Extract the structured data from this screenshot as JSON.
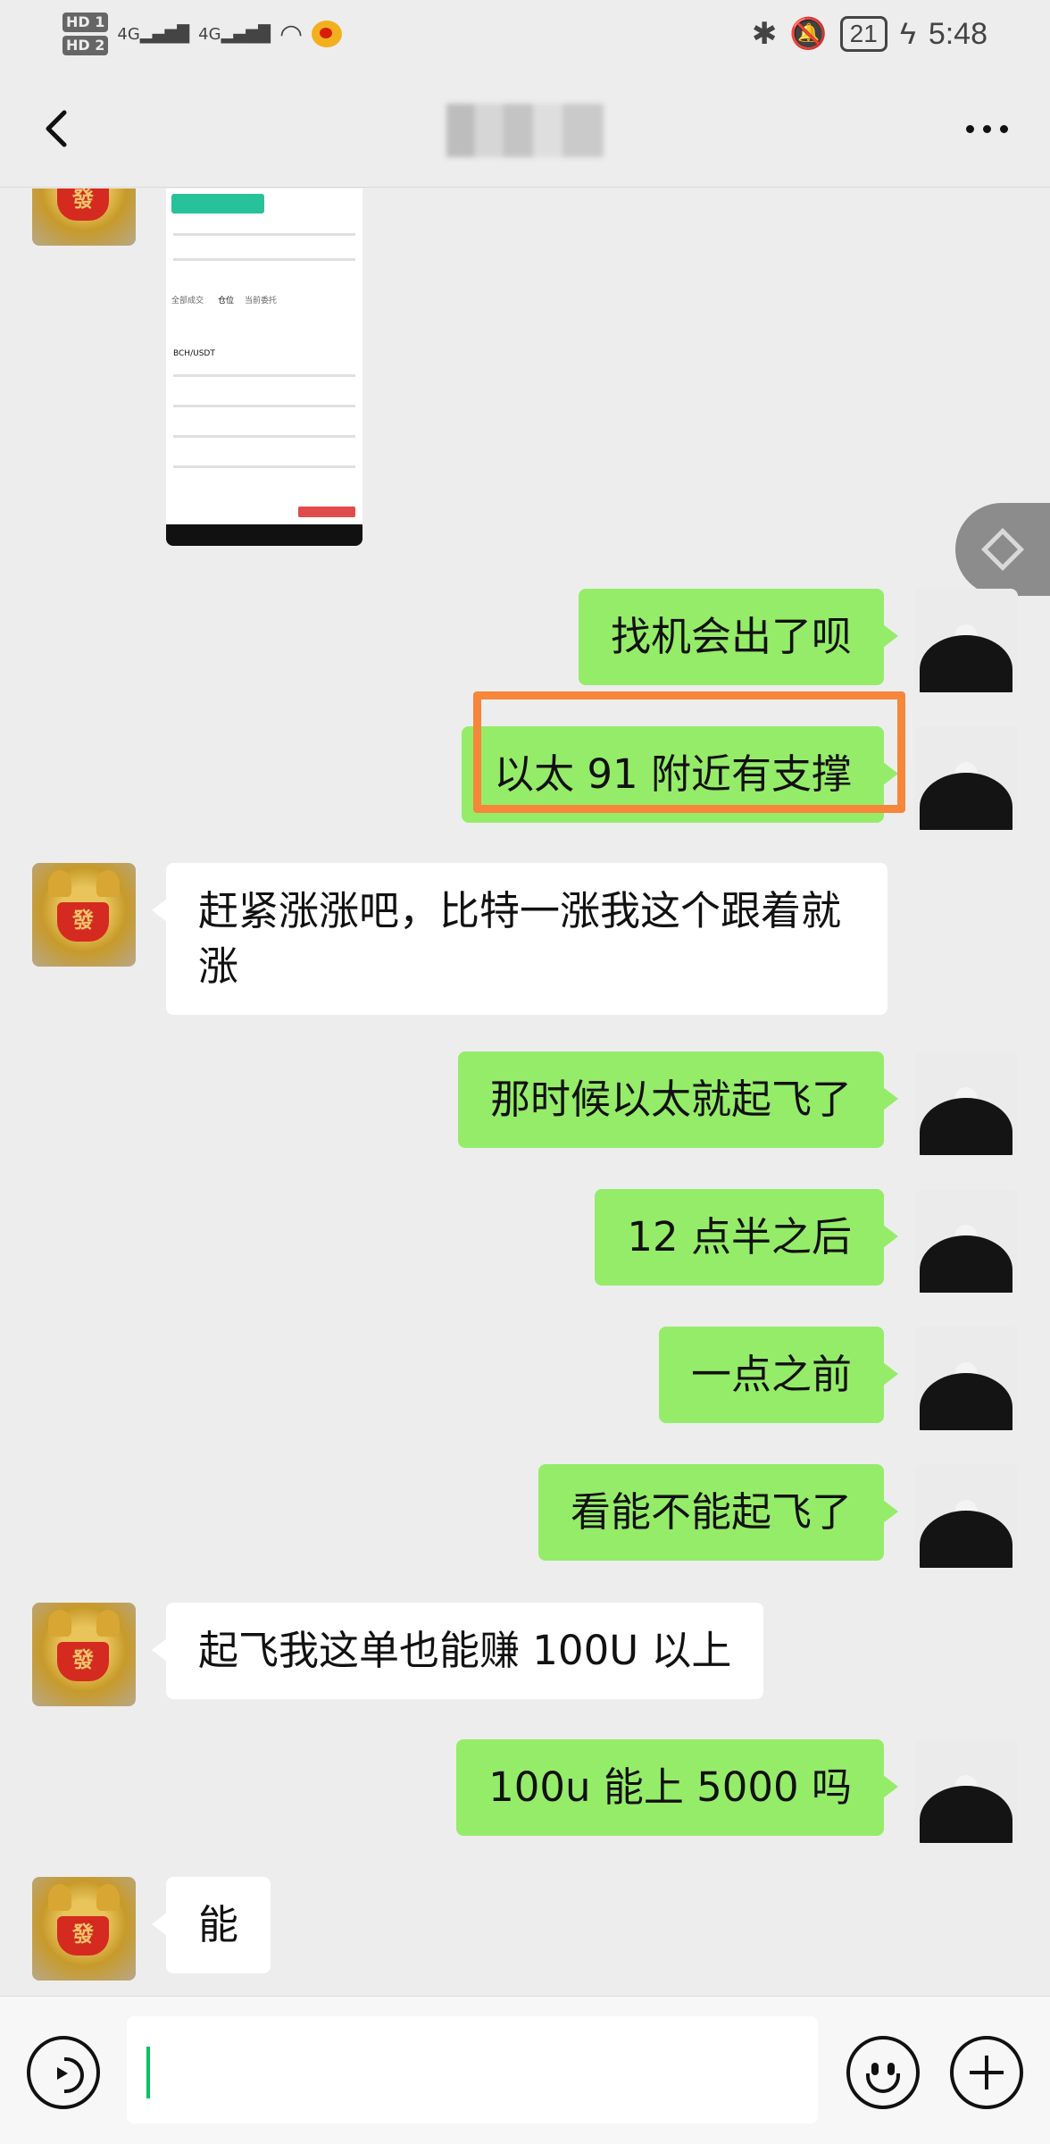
{
  "status_bar": {
    "hd1": "HD 1",
    "hd2": "HD 2",
    "signal1": "4G",
    "signal2": "4G",
    "battery": "21",
    "time": "5:48"
  },
  "nav": {
    "back_icon": "chevron-left-icon",
    "more_icon": "more-horizontal-icon"
  },
  "messages": [
    {
      "side": "me",
      "text": "找机会出了呗"
    },
    {
      "side": "me",
      "text": "以太 91 附近有支撑"
    },
    {
      "side": "other",
      "text": "赶紧涨涨吧，比特一涨我这个跟着就涨"
    },
    {
      "side": "me",
      "text": "那时候以太就起飞了"
    },
    {
      "side": "me",
      "text": "12 点半之后"
    },
    {
      "side": "me",
      "text": "一点之前"
    },
    {
      "side": "me",
      "text": "看能不能起飞了"
    },
    {
      "side": "other",
      "text": "起飞我这单也能赚 100U 以上"
    },
    {
      "side": "me",
      "text": "100u 能上 5000 吗"
    },
    {
      "side": "other",
      "text": "能"
    }
  ],
  "screenshot_thumb": {
    "tabs": [
      "全部成交",
      "仓位",
      "当前委托"
    ],
    "pair": "BCH/USDT"
  },
  "avatar_other": {
    "mask_char": "發"
  },
  "colors": {
    "my_bubble": "#95ec69",
    "other_bubble": "#ffffff",
    "highlight": "#f6863a",
    "background": "#ededed"
  }
}
